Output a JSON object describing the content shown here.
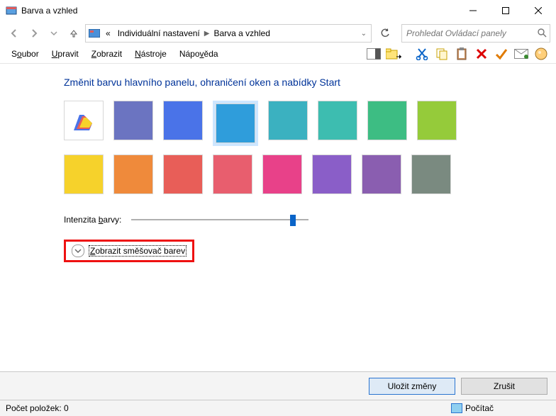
{
  "window": {
    "title": "Barva a vzhled"
  },
  "breadcrumb": {
    "prefix": "«",
    "item1": "Individuální nastavení",
    "item2": "Barva a vzhled"
  },
  "search": {
    "placeholder": "Prohledat Ovládací panely"
  },
  "menus": {
    "file_pre": "S",
    "file_u": "o",
    "file_post": "ubor",
    "edit_pre": "",
    "edit_u": "U",
    "edit_post": "pravit",
    "view_pre": "",
    "view_u": "Z",
    "view_post": "obrazit",
    "tools_pre": "",
    "tools_u": "N",
    "tools_post": "ástroje",
    "help_pre": "Nápo",
    "help_u": "v",
    "help_post": "ěda"
  },
  "heading": "Změnit barvu hlavního panelu, ohraničení oken a nabídky Start",
  "intensity": {
    "label_pre": "Intenzita ",
    "label_u": "b",
    "label_post": "arvy:"
  },
  "mixer": {
    "label_pre": "",
    "label_u": "Z",
    "label_post": "obrazit směšovač barev"
  },
  "buttons": {
    "save": "Uložit změny",
    "cancel": "Zrušit"
  },
  "status": {
    "items_label": "Počet položek: 0",
    "location": "Počítač"
  },
  "colors": {
    "r0c1": "#6b74c1",
    "r0c2": "#4a73e8",
    "r0c3": "#2f9ddb",
    "r0c4": "#3bb1c0",
    "r0c5": "#3dbdb0",
    "r0c6": "#3dbd83",
    "r0c7": "#95cb3a",
    "r1c0": "#f6d22b",
    "r1c1": "#ef8a3b",
    "r1c2": "#e85e58",
    "r1c3": "#e85e6e",
    "r1c4": "#e84189",
    "r1c5": "#8a5ec8",
    "r1c6": "#8a5eb0",
    "r1c7": "#7a8a80"
  }
}
